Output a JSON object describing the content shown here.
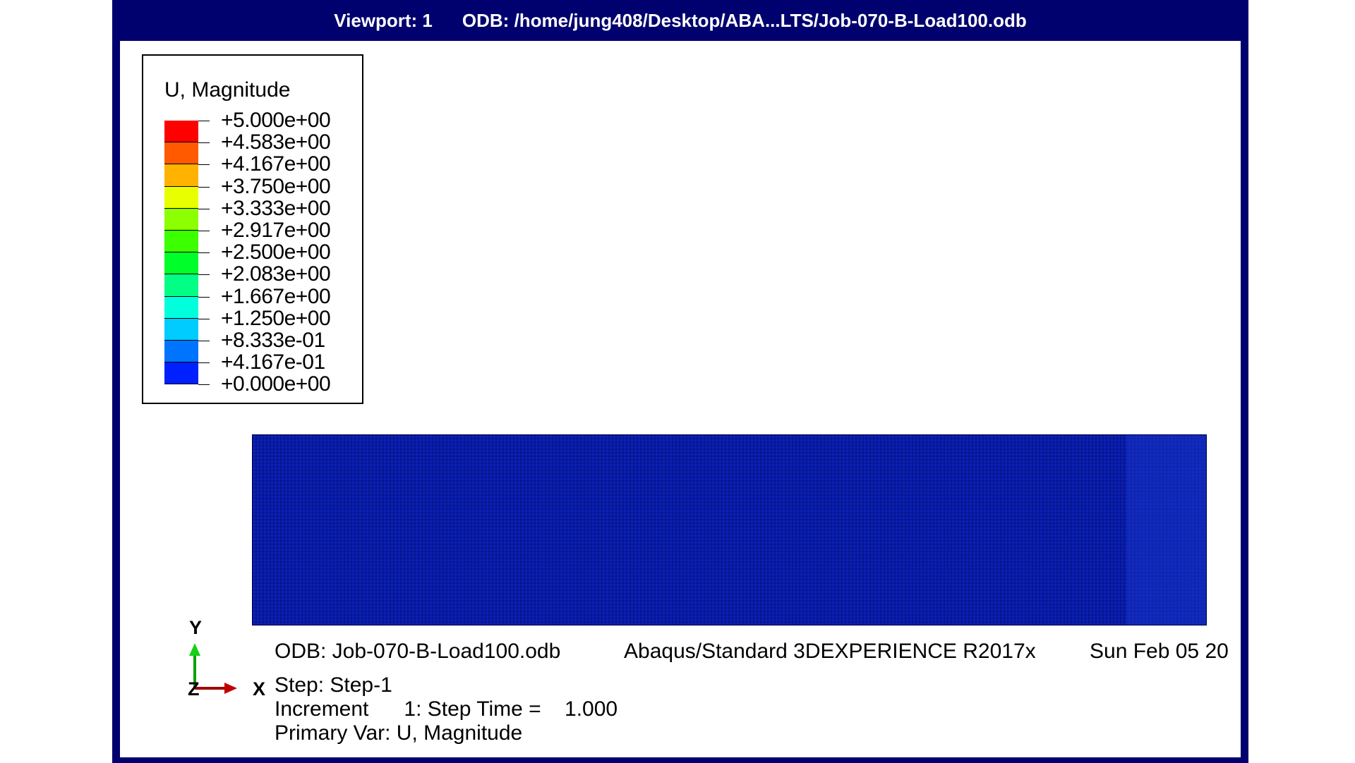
{
  "titlebar": {
    "viewport": "Viewport: 1",
    "odb_path": "ODB: /home/jung408/Desktop/ABA...LTS/Job-070-B-Load100.odb"
  },
  "legend": {
    "title": "U, Magnitude",
    "levels": [
      {
        "label": "+5.000e+00",
        "color": ""
      },
      {
        "label": "+4.583e+00",
        "color": "#ff0000"
      },
      {
        "label": "+4.167e+00",
        "color": "#ff5a00"
      },
      {
        "label": "+3.750e+00",
        "color": "#ffb200"
      },
      {
        "label": "+3.333e+00",
        "color": "#e8ff00"
      },
      {
        "label": "+2.917e+00",
        "color": "#8cff00"
      },
      {
        "label": "+2.500e+00",
        "color": "#3cff00"
      },
      {
        "label": "+2.083e+00",
        "color": "#00ff2a"
      },
      {
        "label": "+1.667e+00",
        "color": "#00ff84"
      },
      {
        "label": "+1.250e+00",
        "color": "#00ffdc"
      },
      {
        "label": "+8.333e-01",
        "color": "#00ccff"
      },
      {
        "label": "+4.167e-01",
        "color": "#0074ff"
      },
      {
        "label": "+0.000e+00",
        "color": "#0020ff"
      }
    ]
  },
  "triad": {
    "y": "Y",
    "z": "Z",
    "x": "X"
  },
  "info": {
    "odb": "ODB: Job-070-B-Load100.odb",
    "solver": "Abaqus/Standard 3DEXPERIENCE R2017x",
    "date": "Sun Feb 05 20",
    "step": "Step: Step-1",
    "increment": "Increment      1: Step Time =    1.000",
    "primary_var": "Primary Var: U, Magnitude"
  },
  "colors": {
    "frame": "#00006e",
    "mesh": "#0a20b8",
    "mesh_lines": "#000030"
  }
}
